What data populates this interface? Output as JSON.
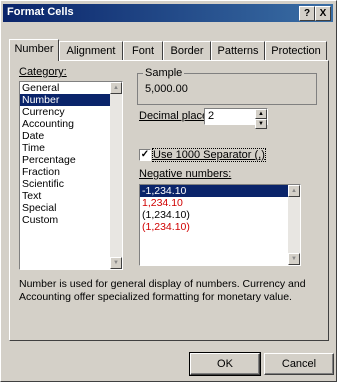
{
  "window": {
    "title": "Format Cells",
    "help_button": "?",
    "close_button": "X"
  },
  "tabs": [
    {
      "label": "Number",
      "active": true
    },
    {
      "label": "Alignment",
      "active": false
    },
    {
      "label": "Font",
      "active": false
    },
    {
      "label": "Border",
      "active": false
    },
    {
      "label": "Patterns",
      "active": false
    },
    {
      "label": "Protection",
      "active": false
    }
  ],
  "category": {
    "label": "Category:",
    "items": [
      "General",
      "Number",
      "Currency",
      "Accounting",
      "Date",
      "Time",
      "Percentage",
      "Fraction",
      "Scientific",
      "Text",
      "Special",
      "Custom"
    ],
    "selected": "Number"
  },
  "sample": {
    "label": "Sample",
    "value": "5,000.00"
  },
  "decimal_places": {
    "label": "Decimal places:",
    "value": "2"
  },
  "separator": {
    "label": "Use 1000 Separator (,)",
    "checked": true
  },
  "negative_numbers": {
    "label": "Negative numbers:",
    "items": [
      {
        "text": "-1,234.10",
        "color": "#000000",
        "selected": true
      },
      {
        "text": "1,234.10",
        "color": "#d00000",
        "selected": false
      },
      {
        "text": "(1,234.10)",
        "color": "#000000",
        "selected": false
      },
      {
        "text": "(1,234.10)",
        "color": "#d00000",
        "selected": false
      }
    ]
  },
  "description": "Number is used for general display of numbers.  Currency and Accounting offer specialized formatting for monetary value.",
  "buttons": {
    "ok": "OK",
    "cancel": "Cancel"
  }
}
